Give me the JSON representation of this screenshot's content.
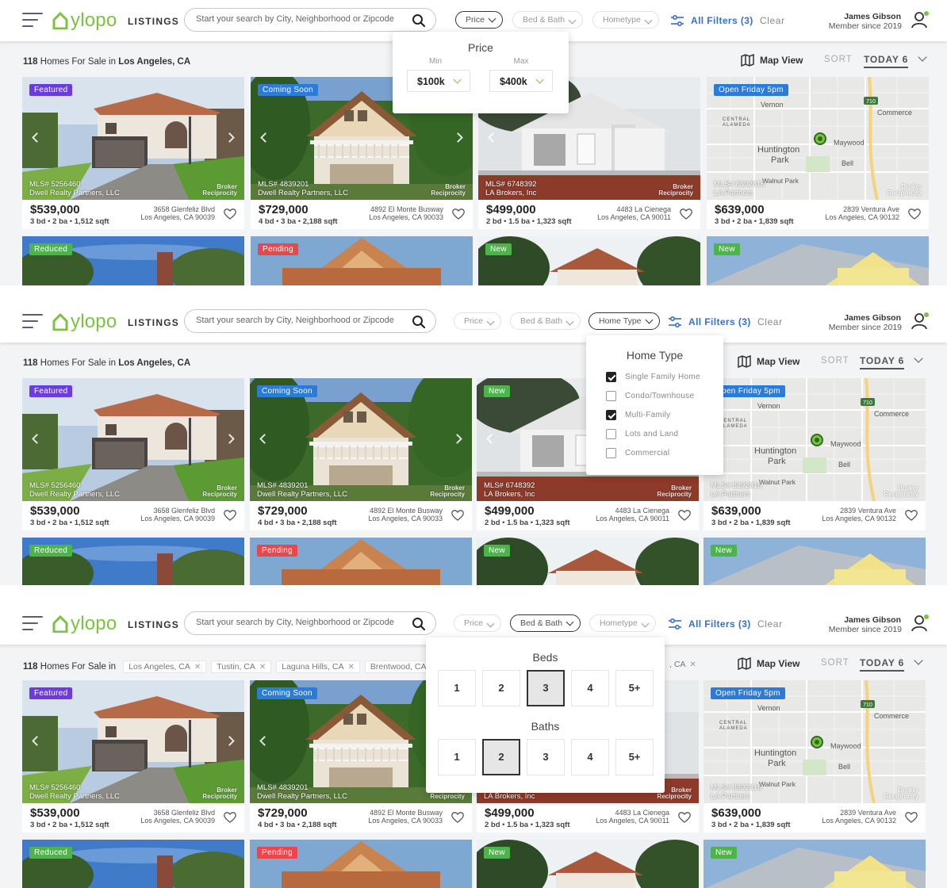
{
  "header": {
    "logo_text": "ylopo",
    "section_label": "LISTINGS",
    "search_placeholder": "Start your search by City, Neighborhood or Zipcode",
    "filters": {
      "price": "Price",
      "bed_bath": "Bed & Bath",
      "hometype": "Hometype",
      "home_type": "Home Type"
    },
    "all_filters": "All Filters (3)",
    "clear": "Clear",
    "user_name": "James Gibson",
    "user_since": "Member since 2019"
  },
  "summary": {
    "count": "118",
    "text": "Homes For Sale in",
    "location": "Los Angeles, CA",
    "location_tags": [
      "Los Angeles, CA",
      "Tustin, CA",
      "Laguna Hills, CA",
      "Brentwood, CA",
      ", CA"
    ],
    "map_view": "Map View",
    "sort_label": "SORT",
    "sort_value": "TODAY 6"
  },
  "listings": [
    {
      "badge": "Featured",
      "mls": "MLS# 5256460",
      "broker": "Dwell Realty Partners, LLC",
      "price": "$539,000",
      "beds": "3 bd",
      "baths": "2 ba",
      "sqft": "1,512 sqft",
      "street": "3658 Glenfeliz Blvd",
      "city": "Los Angeles, CA 90039"
    },
    {
      "badge": "Coming Soon",
      "mls": "MLS# 4839201",
      "broker": "Dwell Realty Partners, LLC",
      "price": "$729,000",
      "beds": "4 bd",
      "baths": "3 ba",
      "sqft": "2,188 sqft",
      "street": "4892 El Monte Busway",
      "city": "Los Angeles, CA 90033"
    },
    {
      "badge": "New",
      "mls": "MLS# 6748392",
      "broker": "LA Brokers, Inc",
      "price": "$499,000",
      "beds": "2 bd",
      "baths": "1.5 ba",
      "sqft": "1,323 sqft",
      "street": "4483 La Cienega",
      "city": "Los Angeles, CA 90011"
    },
    {
      "badge": "Open Friday 5pm",
      "mls": "MLS# 8392816",
      "broker": "LA Partners",
      "price": "$639,000",
      "beds": "3 bd",
      "baths": "2 ba",
      "sqft": "1,839 sqft",
      "street": "2839 Ventura Ave",
      "city": "Los Angeles, CA 90132"
    }
  ],
  "second_row_badges": [
    "Reduced",
    "Pending",
    "New",
    "New"
  ],
  "broker_logo_text": [
    "Broker",
    "Reciprocity"
  ],
  "map_labels": [
    "Vernon",
    "CENTRAL",
    "ALAMEDA",
    "Commerce",
    "Huntington",
    "Park",
    "Maywood",
    "Bell",
    "Walnut Park",
    "710"
  ],
  "price_dropdown": {
    "title": "Price",
    "min_label": "Min",
    "max_label": "Max",
    "min_value": "$100k",
    "max_value": "$400k"
  },
  "hometype_dropdown": {
    "title": "Home Type",
    "options": [
      {
        "label": "Single Family Home",
        "checked": true
      },
      {
        "label": "Condo/Townhouse",
        "checked": false
      },
      {
        "label": "Multi-Family",
        "checked": true
      },
      {
        "label": "Lots and Land",
        "checked": false
      },
      {
        "label": "Commercial",
        "checked": false
      }
    ]
  },
  "bedbath_dropdown": {
    "beds_title": "Beds",
    "baths_title": "Baths",
    "options": [
      "1",
      "2",
      "3",
      "4",
      "5+"
    ],
    "beds_selected": "3",
    "baths_selected": "2"
  },
  "colors": {
    "brand_green": "#7cc242",
    "link_blue": "#3670c9",
    "badge_purple": "#6b3bdf",
    "badge_blue": "#2b7bd8",
    "badge_green": "#4db34b",
    "badge_red": "#e8474c"
  }
}
